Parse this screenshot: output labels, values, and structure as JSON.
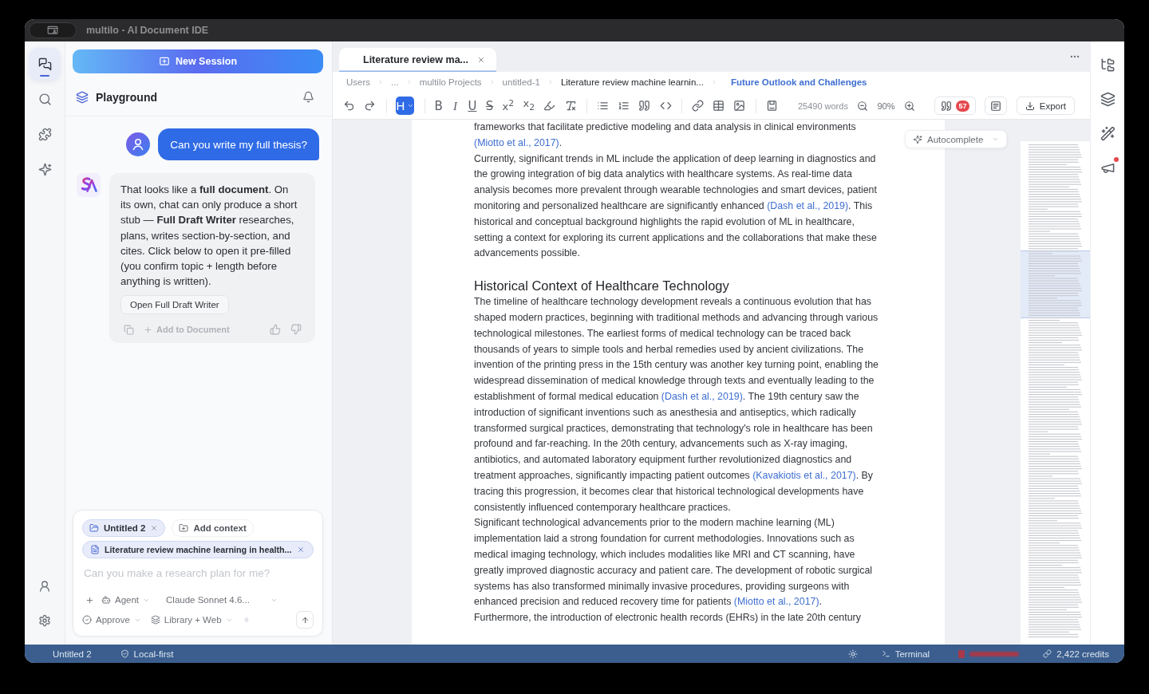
{
  "window": {
    "title": "multilo - AI Document IDE"
  },
  "activity_bar": {
    "items": [
      {
        "selected": true
      },
      {
        "selected": false
      },
      {
        "selected": false
      },
      {
        "selected": false
      }
    ]
  },
  "chat": {
    "new_session": "New Session",
    "title": "Playground",
    "messages": [
      {
        "kind": "user",
        "text": "Can you write my full thesis?"
      },
      {
        "kind": "assistant",
        "text": "That looks like a **full document**. On its own, chat can only produce a short stub — **Full Draft Writer** researches, plans, writes section-by-section, and cites. Click below to open it pre-filled (you confirm topic + length before anything is written).",
        "action": "Open Full Draft Writer",
        "add_to_document": "Add to Document"
      }
    ],
    "composer": {
      "chips": [
        {
          "kind": "folder",
          "label": "Untitled 2"
        },
        {
          "kind": "add",
          "label": "Add context"
        },
        {
          "kind": "document",
          "label": "Literature review machine learning in health..."
        }
      ],
      "placeholder": "Can you make a research plan for me?",
      "mode": "Agent",
      "model": "Claude Sonnet 4.6...",
      "approval": "Approve",
      "sources": "Library + Web"
    }
  },
  "editor": {
    "tabs": [
      {
        "label": "Literature review ma...",
        "selected": true
      }
    ],
    "breadcrumb": [
      {
        "kind": "folder",
        "label": "Users"
      },
      {
        "kind": "folder",
        "label": "..."
      },
      {
        "kind": "folder",
        "label": "multilo Projects"
      },
      {
        "kind": "folder",
        "label": "untitled-1"
      },
      {
        "kind": "file",
        "label": "Literature review machine learnin..."
      },
      {
        "kind": "section",
        "label": "Future Outlook and Challenges"
      }
    ],
    "toolbar": {
      "block_type": {
        "label": "H",
        "selected": true
      },
      "marks": [
        {
          "kind": "bold",
          "label": "B"
        },
        {
          "kind": "italic",
          "label": "I"
        },
        {
          "kind": "underline",
          "label": "U"
        },
        {
          "kind": "strike",
          "label": "S"
        },
        {
          "kind": "script",
          "label": "x$^{2}$"
        },
        {
          "kind": "script",
          "label": "x$_{2}$"
        }
      ],
      "word_count": "25490 words",
      "zoom": "90%",
      "citation_count": "57",
      "export": "Export"
    },
    "autocomplete": "Autocomplete",
    "document": [
      {
        "kind": "paragraph",
        "runs": [
          {
            "kind": "text",
            "text": "frameworks that facilitate predictive modeling and data analysis in clinical environments "
          },
          {
            "kind": "citation",
            "text": "(Miotto et al., 2017)"
          },
          {
            "kind": "text",
            "text": "."
          }
        ]
      },
      {
        "kind": "paragraph",
        "runs": [
          {
            "kind": "text",
            "text": "Currently, significant trends in ML include the application of deep learning in diagnostics and the growing integration of big data analytics with healthcare systems. As real-time data analysis becomes more prevalent through wearable technologies and smart devices, patient monitoring and personalized healthcare are significantly enhanced "
          },
          {
            "kind": "citation",
            "text": "(Dash et al., 2019)"
          },
          {
            "kind": "text",
            "text": ". This historical and conceptual background highlights the rapid evolution of ML in healthcare, setting a context for exploring its current applications and the collaborations that make these advancements possible."
          }
        ]
      },
      {
        "kind": "heading",
        "text": "Historical Context of Healthcare Technology"
      },
      {
        "kind": "paragraph",
        "runs": [
          {
            "kind": "text",
            "text": "The timeline of healthcare technology development reveals a continuous evolution that has shaped modern practices, beginning with traditional methods and advancing through various technological milestones. The earliest forms of medical technology can be traced back thousands of years to simple tools and herbal remedies used by ancient civilizations. The invention of the printing press in the 15th century was another key turning point, enabling the widespread dissemination of medical knowledge through texts and eventually leading to the establishment of formal medical education "
          },
          {
            "kind": "citation",
            "text": "(Dash et al., 2019)"
          },
          {
            "kind": "text",
            "text": ". The 19th century saw the introduction of significant inventions such as anesthesia and antiseptics, which radically transformed surgical practices, demonstrating that technology's role in healthcare has been profound and far-reaching. In the 20th century, advancements such as X-ray imaging, antibiotics, and automated laboratory equipment further revolutionized diagnostics and treatment approaches, significantly impacting patient outcomes "
          },
          {
            "kind": "citation",
            "text": "(Kavakiotis et al., 2017)"
          },
          {
            "kind": "text",
            "text": ". By tracing this progression, it becomes clear that historical technological developments have consistently influenced contemporary healthcare practices."
          }
        ]
      },
      {
        "kind": "paragraph",
        "runs": [
          {
            "kind": "text",
            "text": "Significant technological advancements prior to the modern machine learning (ML) implementation laid a strong foundation for current methodologies. Innovations such as medical imaging technology, which includes modalities like MRI and CT scanning, have greatly improved diagnostic accuracy and patient care. The development of robotic surgical systems has also transformed minimally invasive procedures, providing surgeons with enhanced precision and reduced recovery time for patients "
          },
          {
            "kind": "citation",
            "text": "(Miotto et al., 2017)"
          },
          {
            "kind": "text",
            "text": "."
          }
        ]
      },
      {
        "kind": "paragraph",
        "runs": [
          {
            "kind": "text",
            "text": "Furthermore, the introduction of electronic health records (EHRs) in the late 20th century"
          }
        ]
      }
    ]
  },
  "right_rail": {
    "items": [
      {
        "notification": false
      },
      {
        "notification": false
      },
      {
        "notification": false
      },
      {
        "notification": true
      }
    ]
  },
  "status_bar": {
    "document": "Untitled 2",
    "privacy": "Local-first",
    "terminal": "Terminal",
    "credits": "2,422 credits"
  }
}
